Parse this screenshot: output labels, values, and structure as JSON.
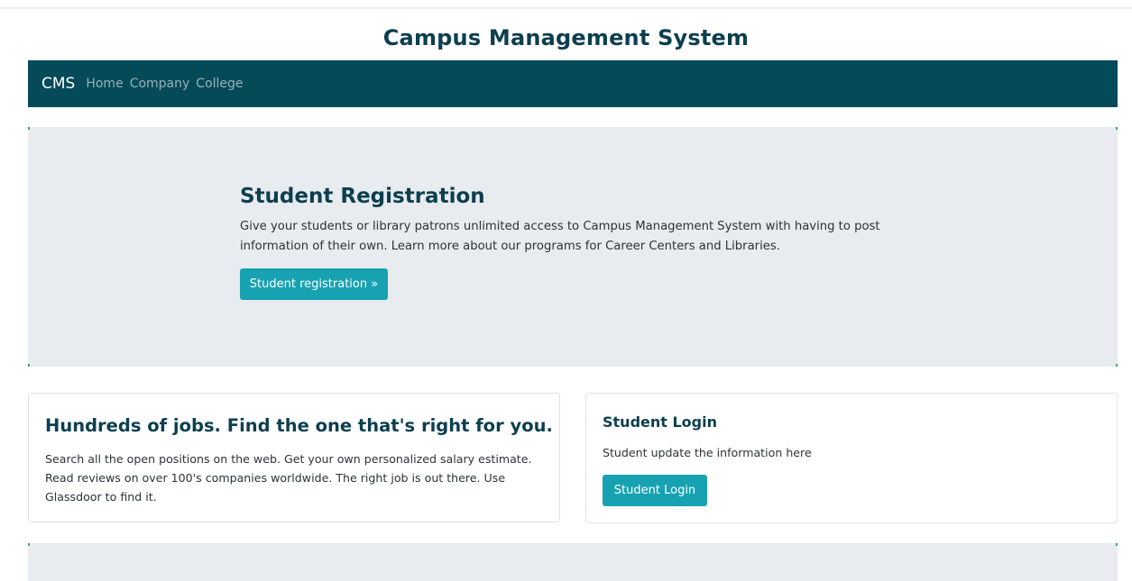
{
  "header": {
    "title": "Campus Management System"
  },
  "navbar": {
    "brand": "CMS",
    "links": [
      "Home",
      "Company",
      "College"
    ],
    "background_color": "#044a59"
  },
  "jumbotron": {
    "title": "Student Registration",
    "text": "Give your students or library patrons unlimited access to Campus Management System with having to post information of their own. Learn more about our programs for Career Centers and Libraries.",
    "button_label": "Student registration »"
  },
  "jobs_card": {
    "title": "Hundreds of jobs. Find the one that's right for you.",
    "text": "Search all the open positions on the web. Get your own personalized salary estimate. Read reviews on over 100's companies worldwide. The right job is out there. Use Glassdoor to find it."
  },
  "login_card": {
    "title": "Student Login",
    "text": "Student update the information here",
    "button_label": "Student Login"
  },
  "colors": {
    "accent": "#17a2b2",
    "panel": "#e8ebef",
    "heading": "#0c3f4f"
  }
}
